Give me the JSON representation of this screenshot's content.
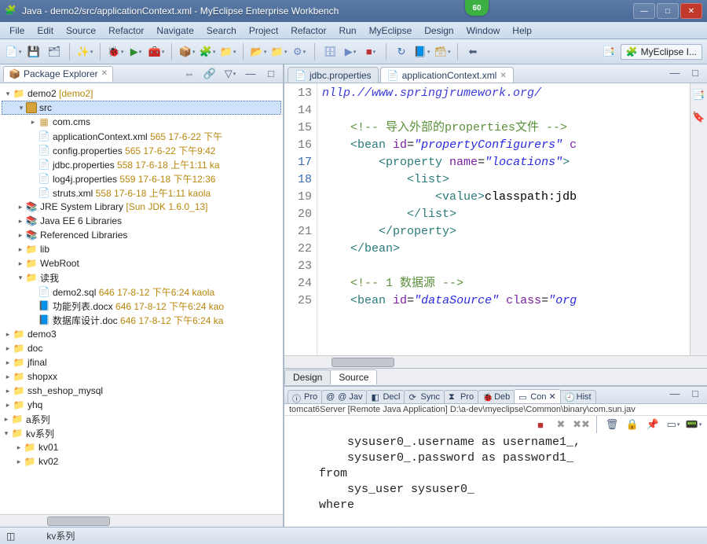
{
  "window_title": "Java - demo2/src/applicationContext.xml - MyEclipse Enterprise Workbench",
  "badge": "60",
  "menus": [
    "File",
    "Edit",
    "Source",
    "Refactor",
    "Navigate",
    "Search",
    "Project",
    "Refactor",
    "Run",
    "MyEclipse",
    "Design",
    "Window",
    "Help"
  ],
  "perspective_label": "MyEclipse I...",
  "pkg_explorer_title": "Package Explorer",
  "tree": {
    "demo2": {
      "label": "demo2",
      "extra": " [demo2]"
    },
    "src": "src",
    "com_cms": "com.cms",
    "appctx": {
      "file": "applicationContext.xml",
      "extra": " 565  17-6-22 下午"
    },
    "config": {
      "file": "config.properties",
      "extra": " 565  17-6-22 下午9:42"
    },
    "jdbc": {
      "file": "jdbc.properties",
      "extra": " 558  17-6-18 上午1:11  ka"
    },
    "log4j": {
      "file": "log4j.properties",
      "extra": " 559  17-6-18 下午12:36"
    },
    "struts": {
      "file": "struts.xml",
      "extra": " 558  17-6-18 上午1:11  kaola"
    },
    "jre": {
      "label": "JRE System Library",
      "extra": " [Sun JDK 1.6.0_13]"
    },
    "javaee": "Java EE 6 Libraries",
    "reflib": "Referenced Libraries",
    "lib": "lib",
    "webroot": "WebRoot",
    "readme": "读我",
    "demo2sql": {
      "file": "demo2.sql",
      "extra": " 646  17-8-12 下午6:24  kaola"
    },
    "gnlb": {
      "file": "功能列表.docx",
      "extra": " 646  17-8-12 下午6:24  kao"
    },
    "sjk": {
      "file": "数据库设计.doc",
      "extra": " 646  17-8-12 下午6:24  ka"
    },
    "demo3": "demo3",
    "doc": "doc",
    "jfinal": "jfinal",
    "shopxx": "shopxx",
    "ssh": "ssh_eshop_mysql",
    "yhq": "yhq",
    "aseries": "a系列",
    "kvseries": "kv系列",
    "kv01": "kv01",
    "kv02": "kv02"
  },
  "editor_tabs": [
    {
      "label": "jdbc.properties",
      "icon": "📄"
    },
    {
      "label": "applicationContext.xml",
      "icon": "📄"
    }
  ],
  "editor": {
    "line13_frag": "nllp.//www.springjrumework.org/",
    "line15_cmt_cn": "导入外部的properties文件",
    "line16_id": "propertyConfigurers",
    "line17_name": "locations",
    "line19_val": "classpath:jdb",
    "line24_cmt": "<!-- 1 数据源 -->",
    "line25_id": "dataSource",
    "line25_class": "org",
    "lines": [
      "13",
      "14",
      "15",
      "16",
      "17",
      "18",
      "19",
      "20",
      "21",
      "22",
      "23",
      "24",
      "25"
    ]
  },
  "design_tabs": [
    "Design",
    "Source"
  ],
  "bottom_tabs": [
    {
      "icon": "🟦",
      "label": "Pro"
    },
    {
      "icon": "🟡",
      "label": "@ Jav"
    },
    {
      "icon": "🟦",
      "label": "Decl"
    },
    {
      "icon": "🔄",
      "label": "Sync"
    },
    {
      "icon": "⚠",
      "label": "Pro"
    },
    {
      "icon": "🐞",
      "label": "Deb"
    },
    {
      "icon": "📟",
      "label": "Con"
    },
    {
      "icon": "🕘",
      "label": "Hist"
    }
  ],
  "console_info": "tomcat6Server [Remote Java Application] D:\\a-dev\\myeclipse\\Common\\binary\\com.sun.jav",
  "console_lines": [
    "        sysuser0_.username as username1_,",
    "        sysuser0_.password as password1_ ",
    "    from",
    "        sys_user sysuser0_ ",
    "    where"
  ],
  "status_text": "kv系列"
}
